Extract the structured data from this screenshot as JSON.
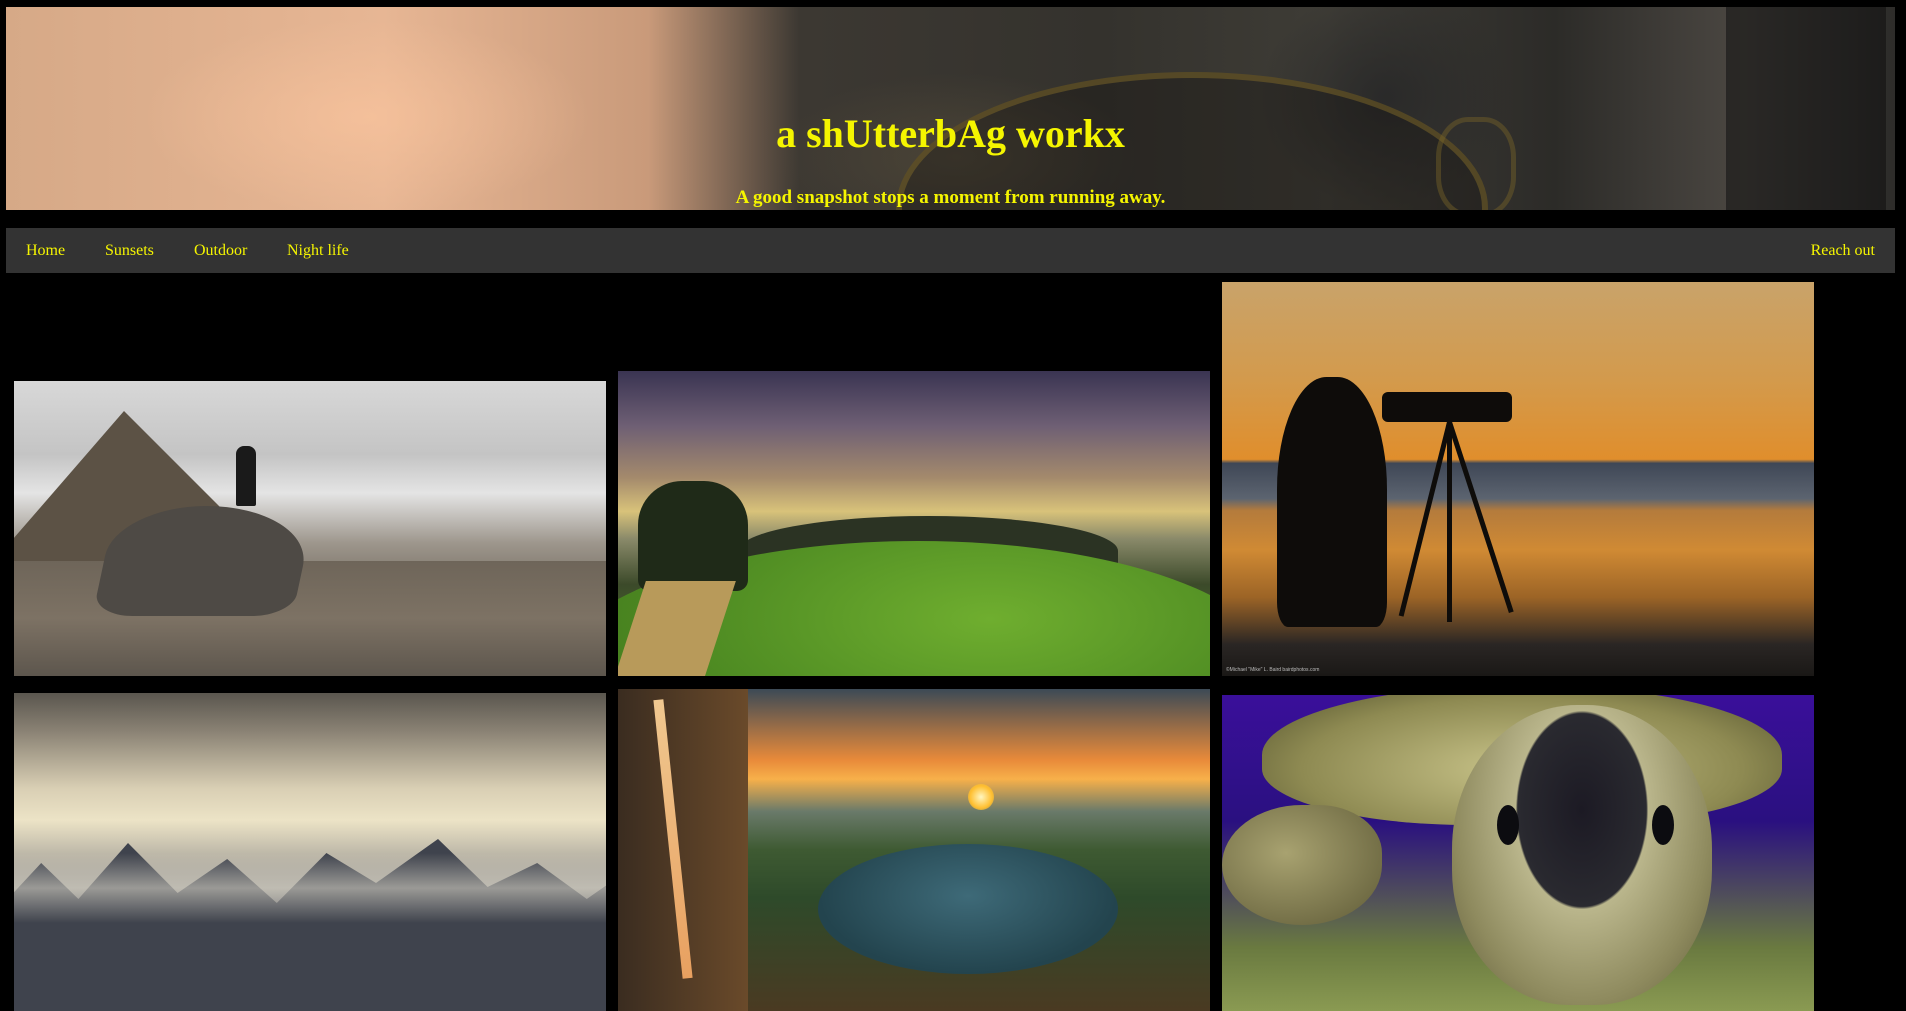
{
  "header": {
    "title": "a shUtterbAg workx",
    "tagline": "A good snapshot stops a moment from running away.",
    "accent_color": "#f5f500"
  },
  "nav": {
    "items": [
      {
        "label": "Home"
      },
      {
        "label": "Sunsets"
      },
      {
        "label": "Outdoor"
      },
      {
        "label": "Night life"
      }
    ],
    "right_item": {
      "label": "Reach out"
    }
  },
  "gallery": {
    "photos": [
      {
        "subject": "hiker-on-rock-above-clouds"
      },
      {
        "subject": "green-valley-under-dramatic-sky"
      },
      {
        "subject": "photographer-silhouette-at-sunset",
        "credit": "©Michael \"Mike\" L. Baird bairdphotos.com"
      },
      {
        "subject": "misty-mountain-peaks"
      },
      {
        "subject": "mountain-lake-with-waterfall"
      },
      {
        "subject": "sea-turtle-closeup"
      }
    ]
  }
}
